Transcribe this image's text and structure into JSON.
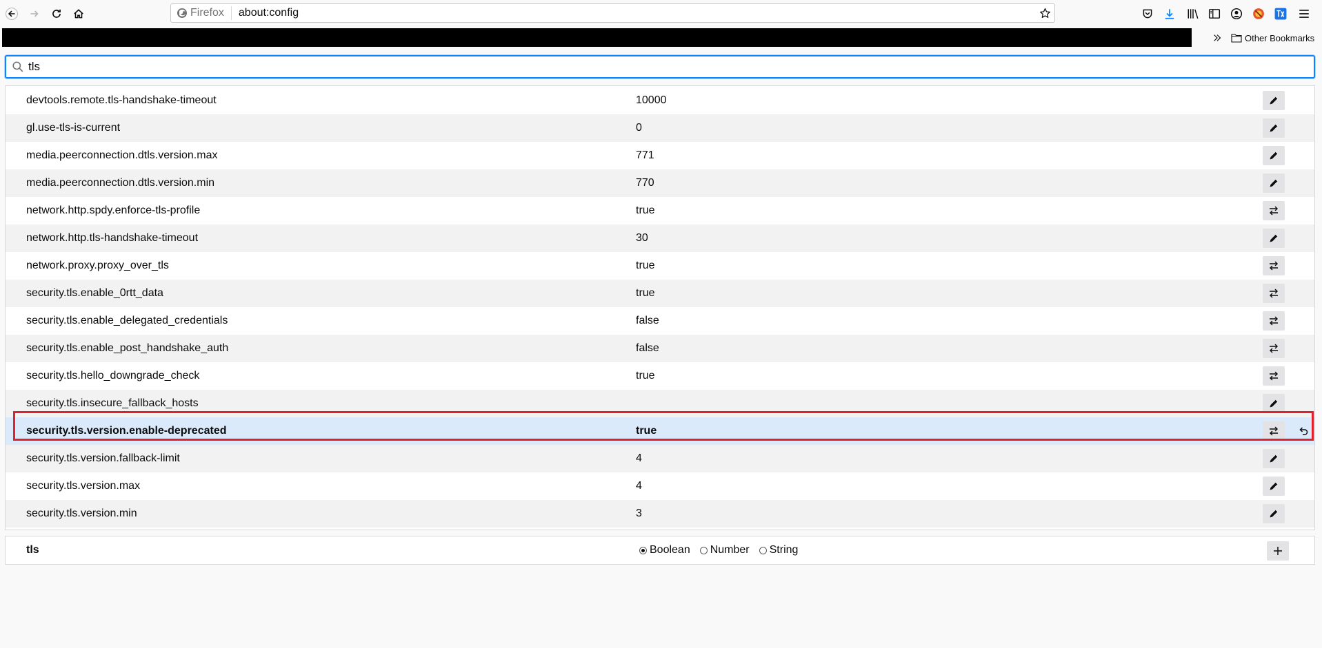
{
  "toolbar": {
    "identity_label": "Firefox",
    "url": "about:config"
  },
  "bookmarks": {
    "other_label": "Other Bookmarks"
  },
  "search": {
    "value": "tls"
  },
  "prefs": [
    {
      "name": "devtools.remote.tls-handshake-timeout",
      "value": "10000",
      "action": "edit",
      "modified": false
    },
    {
      "name": "gl.use-tls-is-current",
      "value": "0",
      "action": "edit",
      "modified": false
    },
    {
      "name": "media.peerconnection.dtls.version.max",
      "value": "771",
      "action": "edit",
      "modified": false
    },
    {
      "name": "media.peerconnection.dtls.version.min",
      "value": "770",
      "action": "edit",
      "modified": false
    },
    {
      "name": "network.http.spdy.enforce-tls-profile",
      "value": "true",
      "action": "toggle",
      "modified": false
    },
    {
      "name": "network.http.tls-handshake-timeout",
      "value": "30",
      "action": "edit",
      "modified": false
    },
    {
      "name": "network.proxy.proxy_over_tls",
      "value": "true",
      "action": "toggle",
      "modified": false
    },
    {
      "name": "security.tls.enable_0rtt_data",
      "value": "true",
      "action": "toggle",
      "modified": false
    },
    {
      "name": "security.tls.enable_delegated_credentials",
      "value": "false",
      "action": "toggle",
      "modified": false
    },
    {
      "name": "security.tls.enable_post_handshake_auth",
      "value": "false",
      "action": "toggle",
      "modified": false
    },
    {
      "name": "security.tls.hello_downgrade_check",
      "value": "true",
      "action": "toggle",
      "modified": false
    },
    {
      "name": "security.tls.insecure_fallback_hosts",
      "value": "",
      "action": "edit",
      "modified": false
    },
    {
      "name": "security.tls.version.enable-deprecated",
      "value": "true",
      "action": "toggle",
      "modified": true
    },
    {
      "name": "security.tls.version.fallback-limit",
      "value": "4",
      "action": "edit",
      "modified": false
    },
    {
      "name": "security.tls.version.max",
      "value": "4",
      "action": "edit",
      "modified": false
    },
    {
      "name": "security.tls.version.min",
      "value": "3",
      "action": "edit",
      "modified": false
    }
  ],
  "add_row": {
    "name": "tls",
    "types": [
      {
        "label": "Boolean",
        "checked": true
      },
      {
        "label": "Number",
        "checked": false
      },
      {
        "label": "String",
        "checked": false
      }
    ]
  },
  "colors": {
    "accent": "#0a84ff",
    "modified_row": "#dbeafb",
    "highlight": "#e0202a"
  },
  "icons": {
    "edit": "pencil-icon",
    "toggle": "toggle-arrows-icon",
    "reset": "reset-icon",
    "add": "plus-icon"
  }
}
